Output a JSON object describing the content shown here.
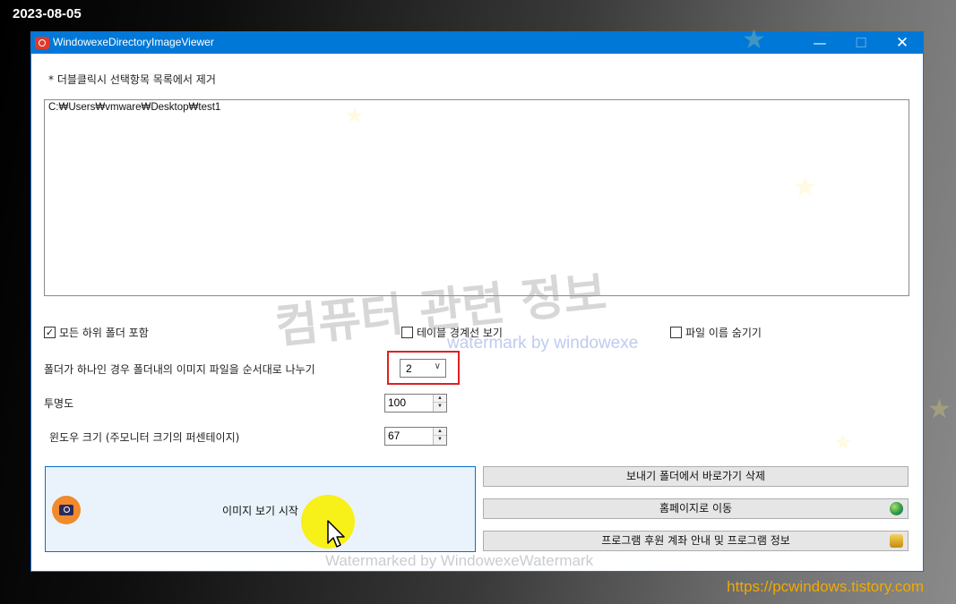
{
  "screen": {
    "date_stamp": "2023-08-05",
    "site_url": "https://pcwindows.tistory.com"
  },
  "window": {
    "title": "WindowexeDirectoryImageViewer",
    "controls": {
      "minimize": "—",
      "maximize": "☐",
      "close": "✕"
    }
  },
  "main": {
    "hint": "* 더블클릭시 선택항목 목록에서 제거",
    "directory_list": [
      "C:₩Users₩vmware₩Desktop₩test1"
    ],
    "checkboxes": {
      "include_subfolders": {
        "label": "모든 하위 폴더 포함",
        "checked": true
      },
      "table_borders": {
        "label": "테이블 경계선 보기",
        "checked": false
      },
      "hide_file_names": {
        "label": "파일 이름 숨기기",
        "checked": false
      }
    },
    "split_setting": {
      "label": "폴더가 하나인 경우 폴더내의 이미지 파일을 순서대로 나누기",
      "value": "2"
    },
    "opacity": {
      "label": "투명도",
      "value": "100"
    },
    "window_size": {
      "label": "윈도우 크기 (주모니터 크기의 퍼센테이지)",
      "value": "67"
    },
    "start_button": {
      "label": "이미지 보기 시작",
      "icon": "camera-icon"
    },
    "side_buttons": [
      {
        "label": "보내기 폴더에서 바로가기 삭제",
        "icon": ""
      },
      {
        "label": "홈페이지로 이동",
        "icon": "globe-icon"
      },
      {
        "label": "프로그램 후원 계좌 안내 및 프로그램 정보",
        "icon": "coins-icon"
      }
    ]
  },
  "watermarks": {
    "big": "컴퓨터 관련 정보",
    "small": "watermark by windowexe",
    "bottom": "Watermarked by WindowexeWatermark"
  },
  "colors": {
    "titlebar": "#0078d7",
    "accent_border": "#0a6fcf",
    "highlight": "#e02020",
    "url": "#f2a900",
    "cursor_halo": "#faf000"
  }
}
